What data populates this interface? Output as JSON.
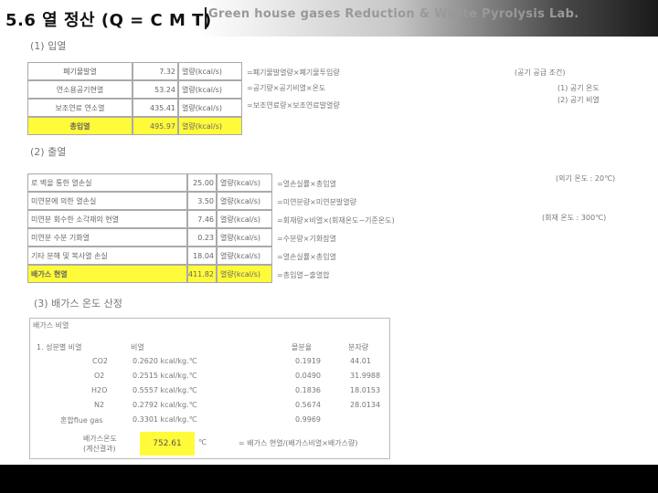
{
  "title": "5.6 열 정산 (Q = C M T)",
  "sections": {
    "s1": "(1) 입열",
    "s2": "(2) 출열",
    "s3": "(3) 배가스 온도 산정"
  },
  "input_rows": [
    {
      "label": "폐기물발열",
      "value": "7.32",
      "unit": "열량(kcal/s)",
      "note": "=폐기물발열량×폐기물투입량"
    },
    {
      "label": "연소용공기현열",
      "value": "53.24",
      "unit": "열량(kcal/s)",
      "note": "=공기량×공기비열×온도"
    },
    {
      "label": "보조연료 연소열",
      "value": "435.41",
      "unit": "열량(kcal/s)",
      "note": "=보조연료량×보조연료발열량"
    },
    {
      "label": "총입열",
      "value": "495.97",
      "unit": "열량(kcal/s)",
      "note": ""
    }
  ],
  "input_side": [
    "(공기 공급 조건)",
    "(1) 공기 온도",
    "(2) 공기 비열"
  ],
  "output_rows": [
    {
      "label": "로 벽을 통한 열손실",
      "value": "25.00",
      "unit": "열량(kcal/s)",
      "note": "=열손실률×총입열"
    },
    {
      "label": "미연분에 의한 열손실",
      "value": "3.50",
      "unit": "열량(kcal/s)",
      "note": "=미연분량×미연분발열량"
    },
    {
      "label": "미연분 회수한 소각재의 현열",
      "value": "7.46",
      "unit": "열량(kcal/s)",
      "note": "=회재량×비열×(회재온도−기준온도)"
    },
    {
      "label": "미연분 수분 기화열",
      "value": "0.23",
      "unit": "열량(kcal/s)",
      "note": "=수분량×기화잠열"
    },
    {
      "label": "기타 분해 및 복사열 손실",
      "value": "18.04",
      "unit": "열량(kcal/s)",
      "note": "=열손실률×총입열"
    },
    {
      "label": "배가스 현열",
      "value": "411.82",
      "unit": "열량(kcal/s)",
      "note": "=총입열−출열합"
    }
  ],
  "output_side": [
    "(외기 온도 : 20℃)",
    "(회재 온도 : 300℃)"
  ],
  "gas": {
    "header": "배가스 비열",
    "sub_header": "1. 성분별 비열",
    "col_heat": "비열",
    "col_frac": "몰분율",
    "col_mw": "분자량",
    "rows": [
      {
        "name": "CO2",
        "heat": "0.2620 kcal/kg.℃",
        "frac": "0.1919",
        "mw": "44.01"
      },
      {
        "name": "O2",
        "heat": "0.2515 kcal/kg.℃",
        "frac": "0.0490",
        "mw": "31.9988"
      },
      {
        "name": "H2O",
        "heat": "0.5557 kcal/kg.℃",
        "frac": "0.1836",
        "mw": "18.0153"
      },
      {
        "name": "N2",
        "heat": "0.2792 kcal/kg.℃",
        "frac": "0.5674",
        "mw": "28.0134"
      },
      {
        "name": "혼합flue gas",
        "heat": "0.3301 kcal/kg.℃",
        "frac": "0.9969",
        "mw": ""
      }
    ],
    "temp_label": "배가스온도",
    "temp_sublabel": "(계산결과)",
    "temp_value": "752.61",
    "temp_unit": "℃",
    "temp_note": "= 배가스 현열/(배가스비열×배가스량)"
  },
  "footer": "Green house gases Reduction & Waste Pyrolysis Lab."
}
